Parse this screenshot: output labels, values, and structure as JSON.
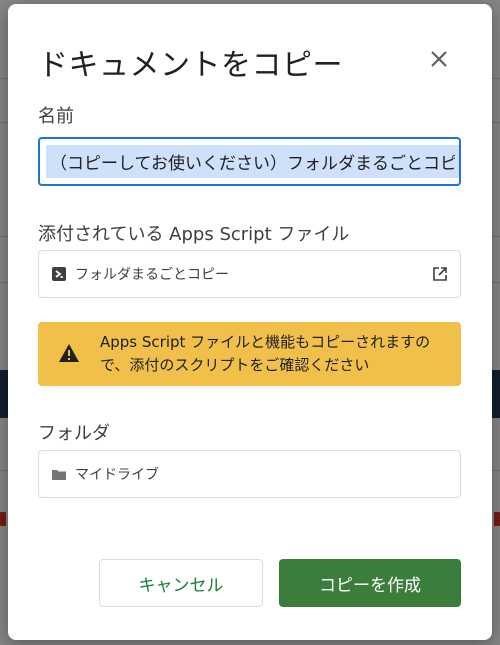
{
  "dialog": {
    "title": "ドキュメントをコピー",
    "close_icon": "close-icon"
  },
  "name_field": {
    "label": "名前",
    "value": "（コピーしてお使いください）フォルダまるごとコピー"
  },
  "script_field": {
    "label": "添付されている Apps Script ファイル",
    "file_name": "フォルダまるごとコピー",
    "left_icon": "script-file-icon",
    "right_icon": "open-in-new-icon"
  },
  "warning": {
    "icon": "warning-icon",
    "text": "Apps Script ファイルと機能もコピーされますので、添付のスクリプトをご確認ください",
    "background": "#f1c04b"
  },
  "folder_field": {
    "label": "フォルダ",
    "value": "マイドライブ",
    "icon": "folder-icon"
  },
  "buttons": {
    "cancel_label": "キャンセル",
    "create_label": "コピーを作成"
  },
  "colors": {
    "primary": "#3b7d3b",
    "accent_text": "#188038",
    "focus_border": "#1a73e8"
  }
}
